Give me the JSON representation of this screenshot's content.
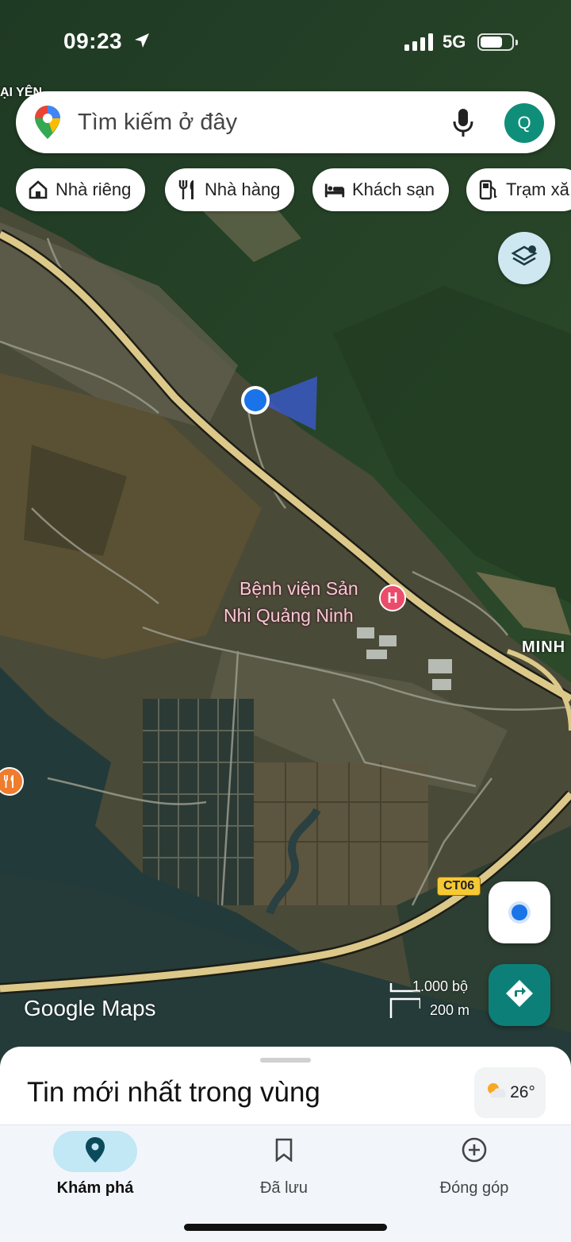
{
  "status_bar": {
    "time": "09:23",
    "network": "5G",
    "battery_level": 0.72,
    "icons": [
      "location-arrow-icon",
      "signal-icon",
      "battery-icon"
    ]
  },
  "map": {
    "corner_label": "ẠI YÊN",
    "hospital_label_line1": "Bệnh viện Sản",
    "hospital_label_line2": "Nhi Quảng Ninh",
    "hospital_pin_letter": "H",
    "area_label": "MINH",
    "road_shield": "CT06",
    "logo": "Google Maps",
    "scale_imperial": "1.000 bộ",
    "scale_metric": "200 m",
    "colors": {
      "road": "#dcc98a",
      "location_dot": "#1a73e8",
      "hospital": "#ea4c69",
      "restaurant": "#f07c2d"
    }
  },
  "search": {
    "placeholder": "Tìm kiếm ở đây",
    "avatar_letter": "Q",
    "icons": [
      "google-maps-pin-icon",
      "microphone-icon"
    ]
  },
  "chips": [
    {
      "label": "Nhà riêng",
      "icon": "home-icon"
    },
    {
      "label": "Nhà hàng",
      "icon": "restaurant-icon"
    },
    {
      "label": "Khách sạn",
      "icon": "hotel-icon"
    },
    {
      "label": "Trạm xă",
      "icon": "gas-station-icon"
    }
  ],
  "sheet": {
    "title": "Tin mới nhất trong vùng",
    "weather_temp": "26°",
    "weather_icon": "partly-cloudy-icon"
  },
  "nav": [
    {
      "label": "Khám phá",
      "icon": "explore-pin-icon",
      "active": true
    },
    {
      "label": "Đã lưu",
      "icon": "bookmark-icon",
      "active": false
    },
    {
      "label": "Đóng góp",
      "icon": "add-circle-icon",
      "active": false
    }
  ],
  "accent_color": "#0f8f7a"
}
